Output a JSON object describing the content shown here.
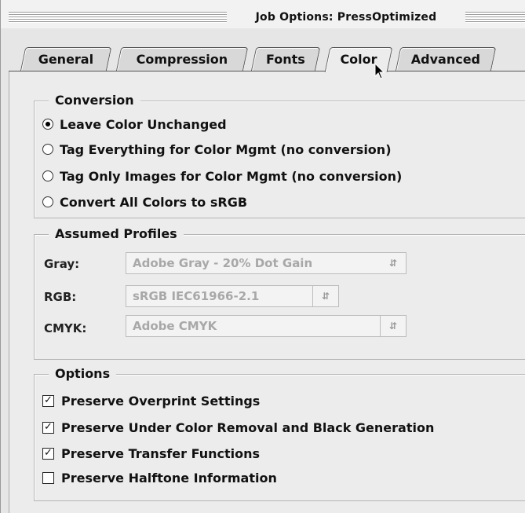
{
  "window": {
    "title": "Job Options: PressOptimized"
  },
  "tabs": [
    {
      "label": "General",
      "active": false
    },
    {
      "label": "Compression",
      "active": false
    },
    {
      "label": "Fonts",
      "active": false
    },
    {
      "label": "Color",
      "active": true
    },
    {
      "label": "Advanced",
      "active": false
    }
  ],
  "conversion": {
    "title": "Conversion",
    "options": [
      {
        "label": "Leave Color Unchanged",
        "selected": true
      },
      {
        "label": "Tag Everything for Color Mgmt (no conversion)",
        "selected": false
      },
      {
        "label": "Tag Only Images for Color Mgmt (no conversion)",
        "selected": false
      },
      {
        "label": "Convert All Colors to sRGB",
        "selected": false
      }
    ]
  },
  "profiles": {
    "title": "Assumed Profiles",
    "gray_label": "Gray:",
    "gray_value": "Adobe Gray - 20% Dot Gain",
    "rgb_label": "RGB:",
    "rgb_value": "sRGB IEC61966-2.1",
    "cmyk_label": "CMYK:",
    "cmyk_value": "Adobe CMYK"
  },
  "options": {
    "title": "Options",
    "items": [
      {
        "label": "Preserve Overprint Settings",
        "checked": true
      },
      {
        "label": "Preserve Under Color Removal and Black Generation",
        "checked": true
      },
      {
        "label": "Preserve Transfer Functions",
        "checked": true
      },
      {
        "label": "Preserve Halftone Information",
        "checked": false
      }
    ]
  },
  "colors": {
    "disabled_text": "#a8a8a8",
    "panel_bg": "#ececec"
  },
  "icons": {
    "select_arrows": "up-down-arrows-icon",
    "cursor": "arrow-cursor-icon"
  }
}
